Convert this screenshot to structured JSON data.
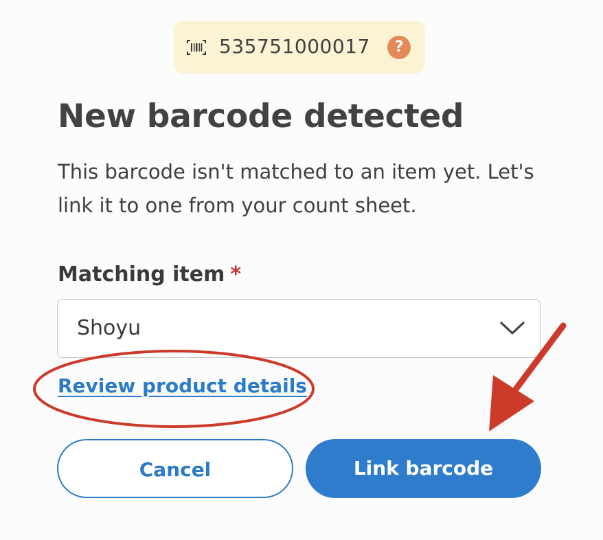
{
  "barcode": {
    "number": "535751000017",
    "icon": "barcode-icon",
    "help_icon": "question-mark-icon",
    "help_label": "?",
    "chip_color": "#fbf3d3",
    "help_color": "#e28a58"
  },
  "dialog": {
    "title": "New barcode detected",
    "description": "This barcode isn't matched to an item yet. Let's link it to one from your count sheet."
  },
  "matching_item": {
    "label": "Matching item",
    "required_mark": "*",
    "selected_value": "Shoyu",
    "dropdown_icon": "chevron-down-icon"
  },
  "review_link": {
    "label": "Review product details"
  },
  "actions": {
    "cancel_label": "Cancel",
    "link_label": "Link barcode"
  },
  "annotations": {
    "highlight": "red-ellipse",
    "pointer": "red-arrow",
    "color": "#cc3a2a"
  },
  "colors": {
    "accent": "#2f7ccd",
    "text": "#3d3d3d",
    "required": "#c62f2f"
  }
}
